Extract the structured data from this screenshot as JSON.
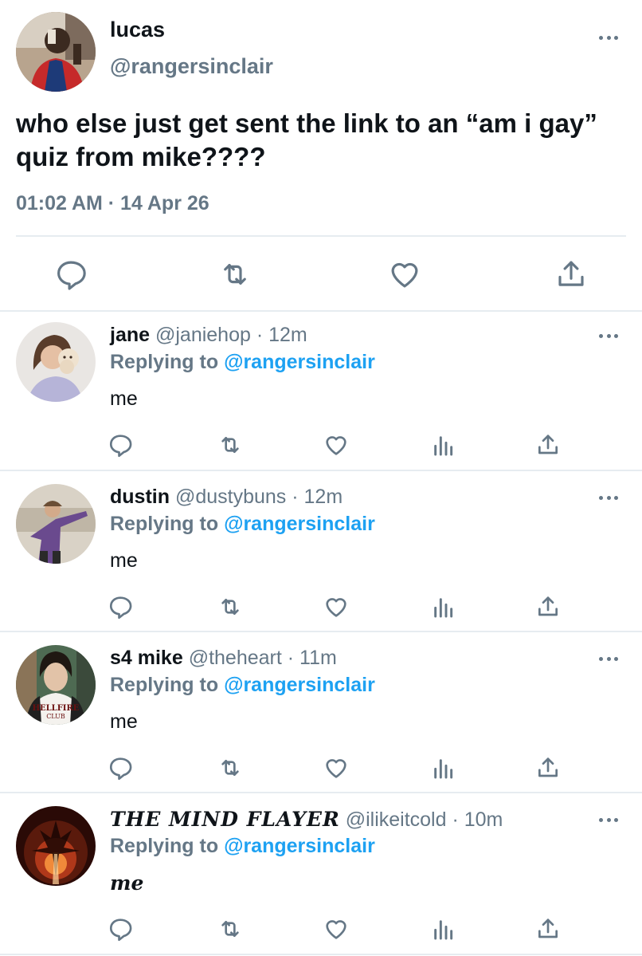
{
  "main_tweet": {
    "display_name": "lucas",
    "handle": "@rangersinclair",
    "text": "who else just get sent the link to an “am i gay” quiz from mike????",
    "meta": "01:02 AM · 14 Apr 26"
  },
  "replies": [
    {
      "name": "jane",
      "handle": "@janiehop",
      "time": " · 12m",
      "replying_prefix": "Replying to",
      "replying_to": "@rangersinclair",
      "text": "me"
    },
    {
      "name": "dustin",
      "handle": "@dustybuns",
      "time": " · 12m",
      "replying_prefix": "Replying to",
      "replying_to": "@rangersinclair",
      "text": "me"
    },
    {
      "name": "s4 mike",
      "handle": "@theheart",
      "time": " · 11m",
      "replying_prefix": "Replying to",
      "replying_to": "@rangersinclair",
      "text": "me"
    },
    {
      "name": "THE MIND FLAYER",
      "handle": "@ilikeitcold",
      "time": " · 10m",
      "replying_prefix": "Replying to",
      "replying_to": "@rangersinclair",
      "text": "me"
    }
  ],
  "avatar_lettering": "HELLFIRE CLUB",
  "colors": {
    "text": "#0f1419",
    "secondary": "#657786",
    "link": "#1da1f2",
    "divider": "#e6ecf0"
  },
  "icons": [
    "reply-icon",
    "retweet-icon",
    "like-icon",
    "analytics-icon",
    "share-icon",
    "more-icon"
  ]
}
